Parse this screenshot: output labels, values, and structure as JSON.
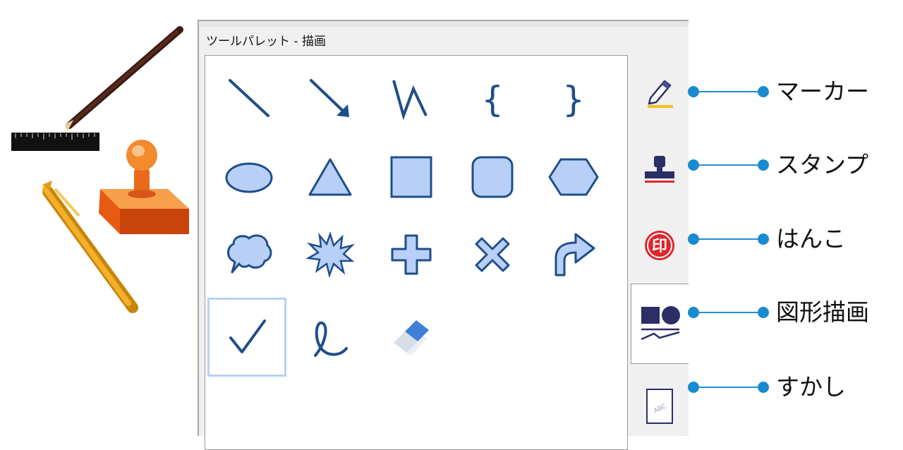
{
  "palette": {
    "title": "ツールパレット - 描画"
  },
  "tools": [
    {
      "name": "line-tool",
      "icon": "line-icon"
    },
    {
      "name": "arrow-tool",
      "icon": "arrow-icon"
    },
    {
      "name": "freeline-tool",
      "icon": "zigzag-icon"
    },
    {
      "name": "left-brace-tool",
      "icon": "left-brace-icon"
    },
    {
      "name": "right-brace-tool",
      "icon": "right-brace-icon"
    },
    {
      "name": "ellipse-tool",
      "icon": "ellipse-icon"
    },
    {
      "name": "triangle-tool",
      "icon": "triangle-icon"
    },
    {
      "name": "rectangle-tool",
      "icon": "rectangle-icon"
    },
    {
      "name": "rounded-rectangle-tool",
      "icon": "rounded-rectangle-icon"
    },
    {
      "name": "hexagon-tool",
      "icon": "hexagon-icon"
    },
    {
      "name": "speech-bubble-tool",
      "icon": "speech-bubble-icon"
    },
    {
      "name": "explosion-tool",
      "icon": "explosion-icon"
    },
    {
      "name": "plus-tool",
      "icon": "plus-icon"
    },
    {
      "name": "cross-tool",
      "icon": "cross-icon"
    },
    {
      "name": "curved-arrow-tool",
      "icon": "curved-arrow-icon"
    },
    {
      "name": "check-tool",
      "icon": "check-icon",
      "selected": true
    },
    {
      "name": "freehand-tool",
      "icon": "freehand-icon"
    },
    {
      "name": "eraser-tool",
      "icon": "eraser-icon"
    }
  ],
  "tabs": [
    {
      "name": "tab-marker",
      "icon": "marker-icon"
    },
    {
      "name": "tab-stamp",
      "icon": "stamp-icon"
    },
    {
      "name": "tab-hanko",
      "icon": "hanko-icon",
      "glyph": "印"
    },
    {
      "name": "tab-shape-drawing",
      "icon": "shapes-icon",
      "active": true
    },
    {
      "name": "tab-watermark",
      "icon": "watermark-icon",
      "glyph": "ABC"
    }
  ],
  "callouts": [
    {
      "label": "マーカー"
    },
    {
      "label": "スタンプ"
    },
    {
      "label": "はんこ"
    },
    {
      "label": "図形描画"
    },
    {
      "label": "すかし"
    }
  ],
  "colors": {
    "icon_stroke": "#1f4e8a",
    "icon_fill": "#b8d0f8",
    "selection": "#b9d1f3",
    "callout": "#1a8ad0",
    "hanko_red": "#e0252b"
  }
}
